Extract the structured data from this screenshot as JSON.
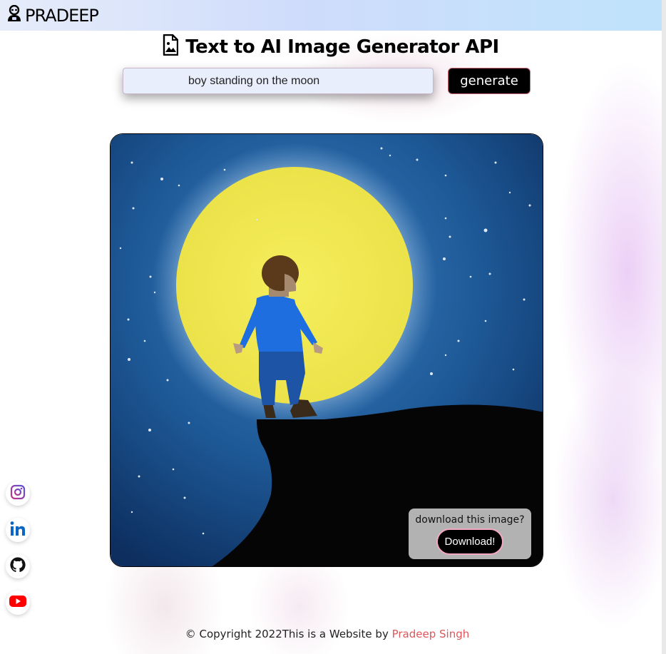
{
  "navbar": {
    "brand": "PRADEEP",
    "logo_icon": "robot-icon"
  },
  "header": {
    "title": "Text to AI Image Generator API",
    "title_icon": "image-file-icon"
  },
  "form": {
    "prompt_value": "boy standing on the moon",
    "generate_label": "generate"
  },
  "result": {
    "download_question": "download this image?",
    "download_label": "Download!"
  },
  "socials": [
    {
      "name": "instagram-icon",
      "color": "#7b3fb8"
    },
    {
      "name": "linkedin-icon",
      "color": "#0a66c2"
    },
    {
      "name": "github-icon",
      "color": "#111111"
    },
    {
      "name": "youtube-icon",
      "color": "#ff0000"
    }
  ],
  "footer": {
    "copyright": "© Copyright 2022This is a Website by ",
    "author": "Pradeep Singh",
    "author_color": "#e0555a"
  }
}
